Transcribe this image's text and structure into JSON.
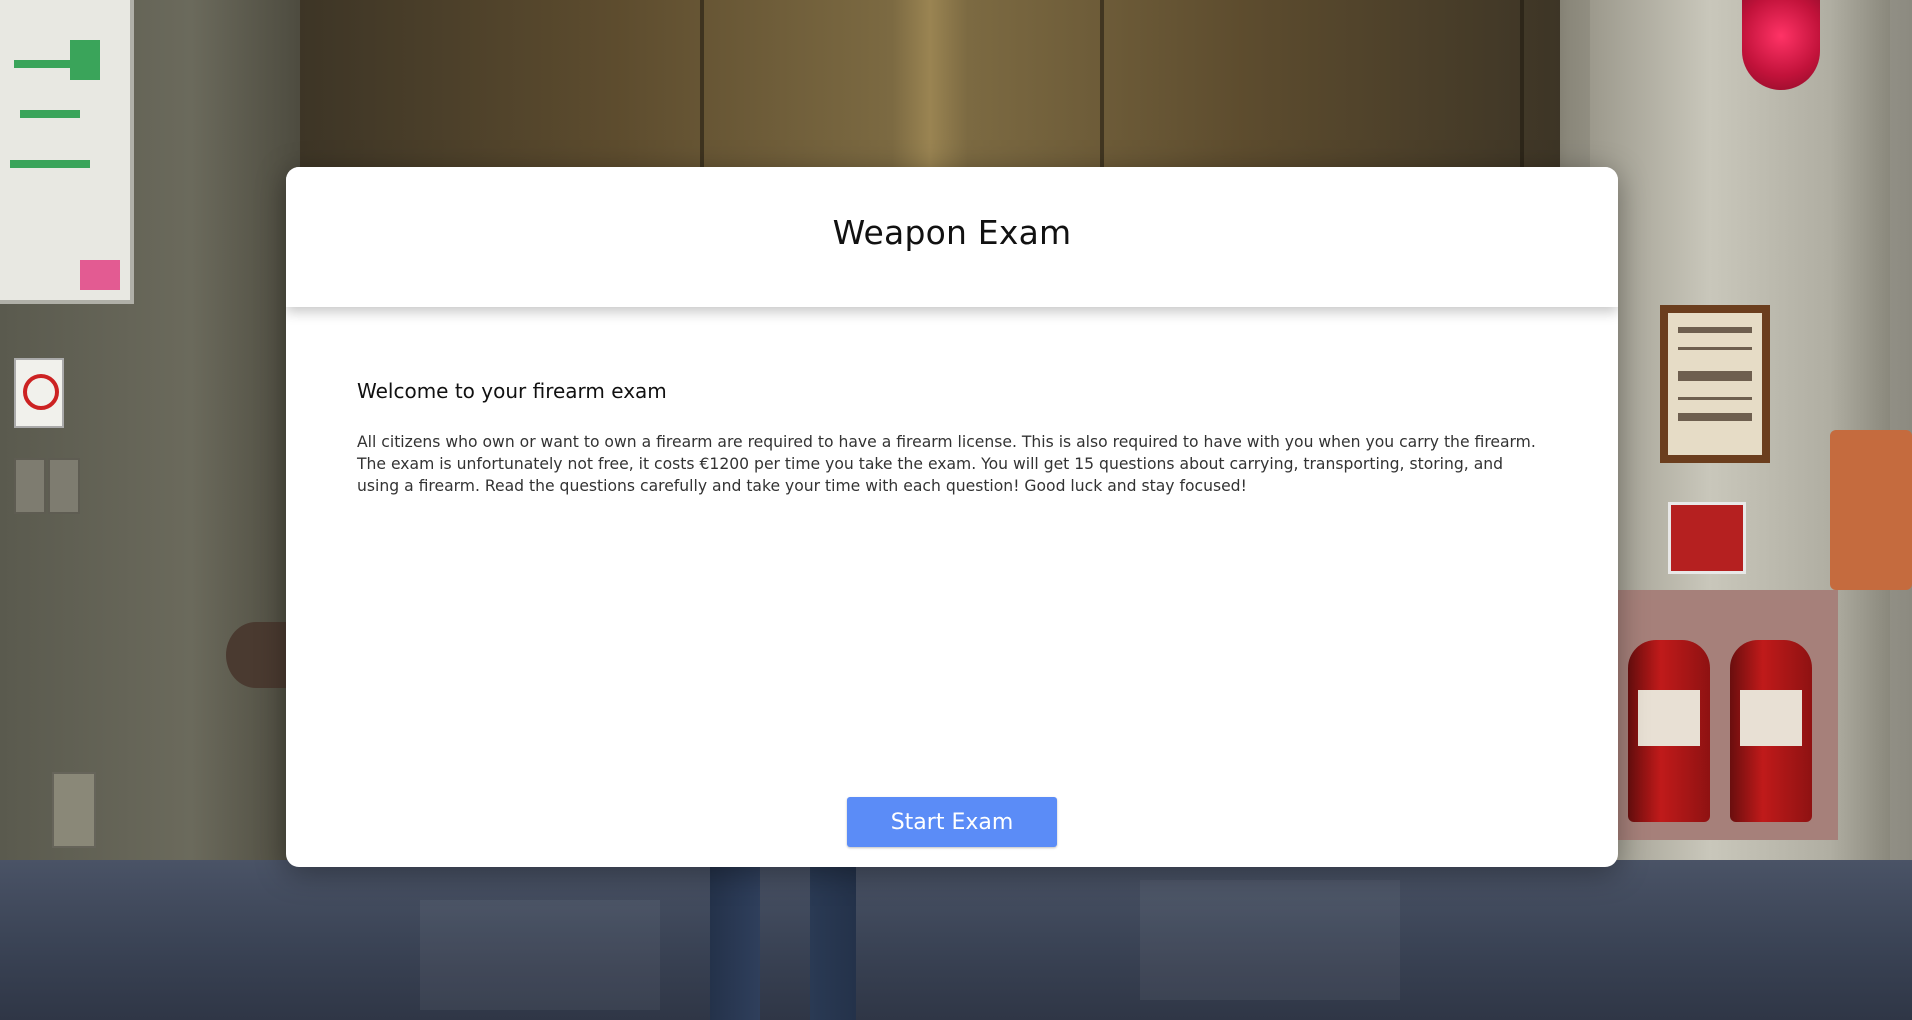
{
  "modal": {
    "title": "Weapon Exam",
    "heading": "Welcome to your firearm exam",
    "description": "All citizens who own or want to own a firearm are required to have a firearm license. This is also required to have with you when you carry the firearm. The exam is unfortunately not free, it costs €1200 per time you take the exam. You will get 15 questions about carrying, transporting, storing, and using a firearm. Read the questions carefully and take your time with each question! Good luck and stay focused!",
    "start_button_label": "Start Exam"
  },
  "colors": {
    "button": "#5b8cf7",
    "modal_background": "#ffffff"
  }
}
